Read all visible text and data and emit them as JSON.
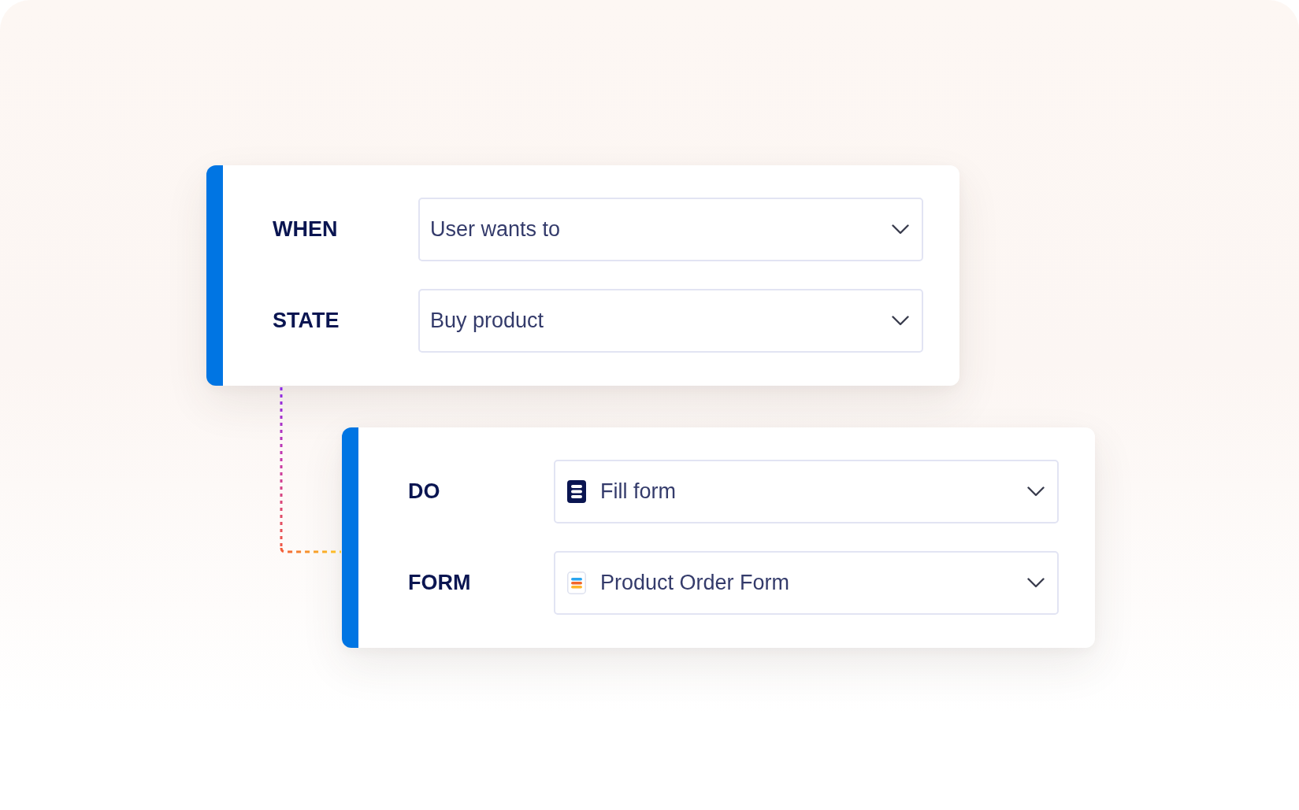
{
  "rule": {
    "rows": [
      {
        "kind": "text",
        "label": "WHEN",
        "value": "User wants to"
      },
      {
        "kind": "text",
        "label": "STATE",
        "value": "Buy product"
      }
    ],
    "children": [
      {
        "rows": [
          {
            "kind": "action",
            "label": "DO",
            "value": "Fill form"
          },
          {
            "kind": "form",
            "label": "FORM",
            "value": "Product Order Form"
          }
        ]
      }
    ]
  }
}
